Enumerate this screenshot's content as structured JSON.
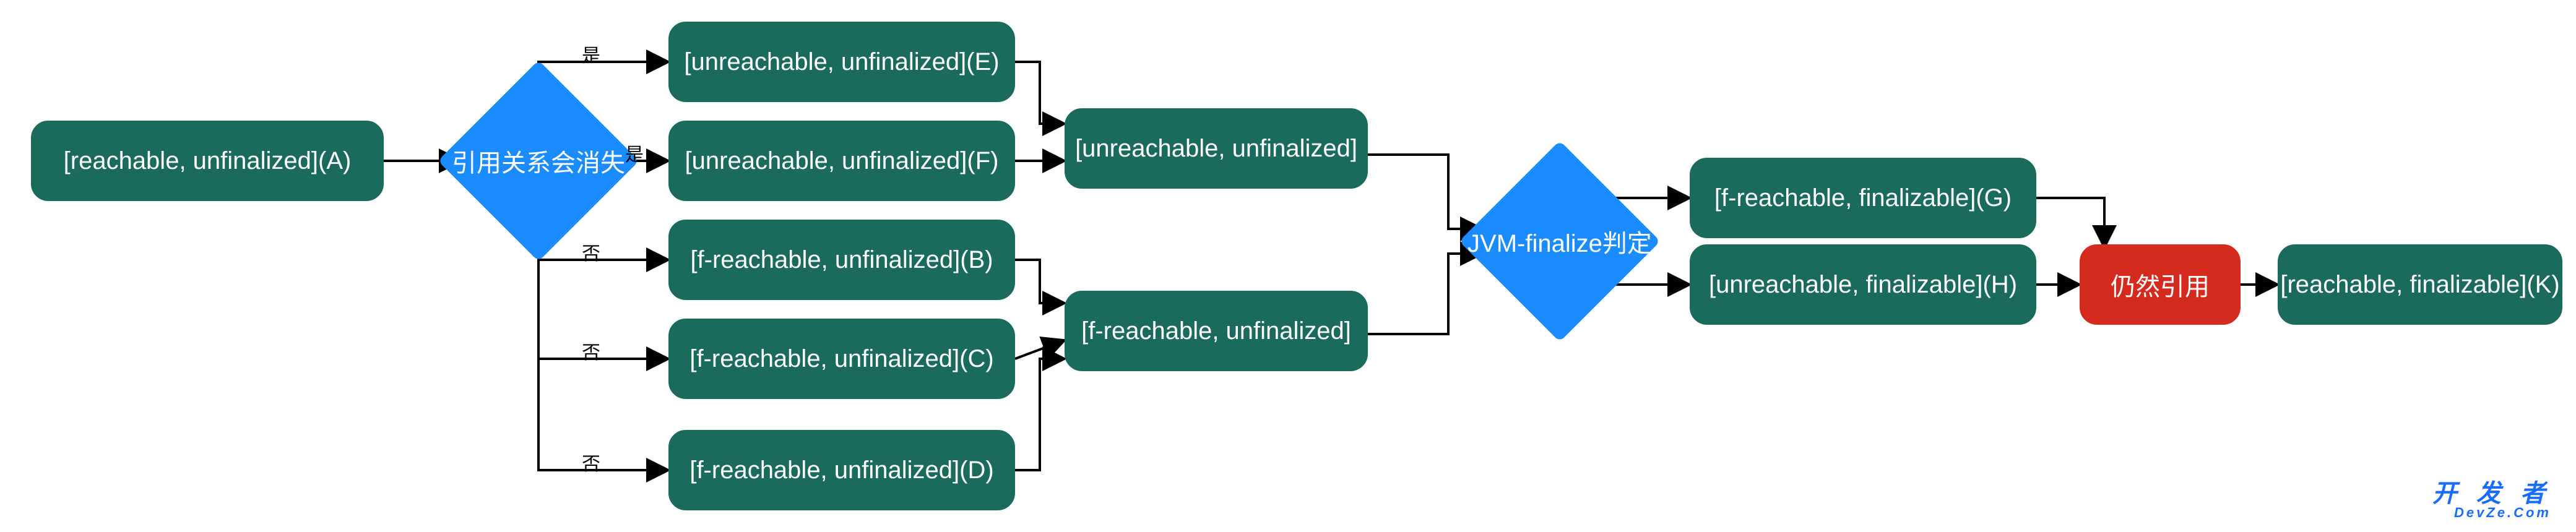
{
  "nodes": {
    "A": {
      "label": "[reachable, unfinalized](A)"
    },
    "E": {
      "label": "[unreachable, unfinalized](E)"
    },
    "F": {
      "label": "[unreachable, unfinalized](F)"
    },
    "B": {
      "label": "[f-reachable, unfinalized](B)"
    },
    "C": {
      "label": "[f-reachable, unfinalized](C)"
    },
    "D": {
      "label": "[f-reachable, unfinalized](D)"
    },
    "U": {
      "label": "[unreachable, unfinalized]"
    },
    "FR": {
      "label": "[f-reachable, unfinalized]"
    },
    "G": {
      "label": "[f-reachable, finalizable](G)"
    },
    "H": {
      "label": "[unreachable, finalizable](H)"
    },
    "K": {
      "label": "[reachable, finalizable](K)"
    }
  },
  "diamonds": {
    "d1": {
      "label": "引用关系会消失"
    },
    "d2": {
      "label": "JVM-finalize判定"
    }
  },
  "red_node": {
    "label": "仍然引用"
  },
  "edge_labels": {
    "yes": "是",
    "no": "否"
  },
  "watermark": {
    "main": "开 发 者",
    "sub": "DevZe.Com"
  },
  "colors": {
    "green": "#1a6b5b",
    "blue": "#1a8cff",
    "red": "#d52b1e"
  }
}
